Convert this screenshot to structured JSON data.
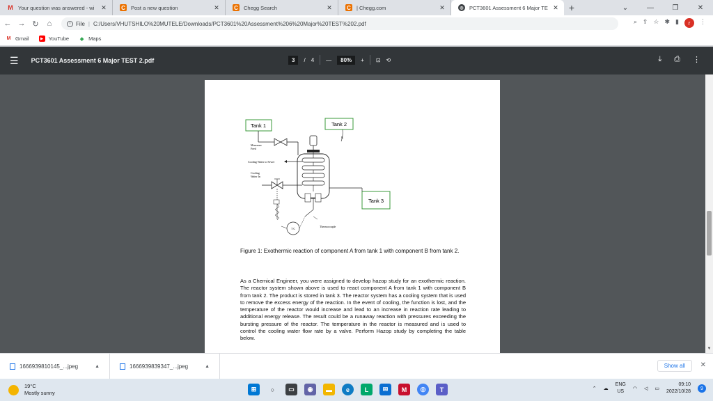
{
  "tabs": [
    {
      "title": "Your question was answered - wi",
      "icon": "gmail"
    },
    {
      "title": "Post a new question",
      "icon": "chegg"
    },
    {
      "title": "Chegg Search",
      "icon": "chegg"
    },
    {
      "title": "| Chegg.com",
      "icon": "chegg"
    },
    {
      "title": "PCT3601 Assessment 6 Major TE",
      "icon": "globe"
    }
  ],
  "address_bar": {
    "scheme": "File",
    "url": "C:/Users/VHUTSHILO%20MUTELE/Downloads/PCT3601%20Assessment%206%20Major%20TEST%202.pdf"
  },
  "bookmarks": [
    "Gmail",
    "YouTube",
    "Maps"
  ],
  "pdf_toolbar": {
    "title": "PCT3601 Assessment 6 Major TEST 2.pdf",
    "current_page": "3",
    "page_sep": "/",
    "total_pages": "4",
    "zoom_minus": "—",
    "zoom": "80%",
    "zoom_plus": "+"
  },
  "diagram": {
    "tank1": "Tank 1",
    "tank2": "Tank 2",
    "tank3": "Tank 3",
    "monomer_feed_1": "Monomer",
    "monomer_feed_2": "Feed",
    "cooling_water_sewer": "Cooling Water to Sewer",
    "cooling_water_in_1": "Cooling",
    "cooling_water_in_2": "Water In",
    "thermocouple": "Thermocouple",
    "b_label": "B",
    "tc_label": "T C"
  },
  "document": {
    "caption": "Figure 1: Exothermic reaction of component A from tank 1 with component B from tank 2.",
    "body": "As a Chemical Engineer, you were assigned to develop hazop study for an exothermic reaction. The reactor system shown above is used to react component A from tank 1 with component B from tank 2. The product is stored in tank 3. The reactor system has a cooling system that is used to remove the excess energy of the reaction. In the event of cooling, the function is lost, and the temperature of the reactor would increase and lead to an increase in reaction rate leading to additional energy release. The result could be a runaway reaction with pressures exceeding the bursting pressure of the reactor. The temperature in the reactor is measured and is used to control the cooling water flow rate by a valve. Perform Hazop study by completing the table below."
  },
  "downloads": [
    {
      "name": "1666939810145_...jpeg"
    },
    {
      "name": "1666939839347_...jpeg"
    }
  ],
  "download_shelf": {
    "show_all": "Show all"
  },
  "taskbar": {
    "temperature": "19°C",
    "weather": "Mostly sunny",
    "lang": "ENG",
    "region": "US",
    "time": "09:10",
    "date": "2022/10/28",
    "notifications": "9"
  }
}
